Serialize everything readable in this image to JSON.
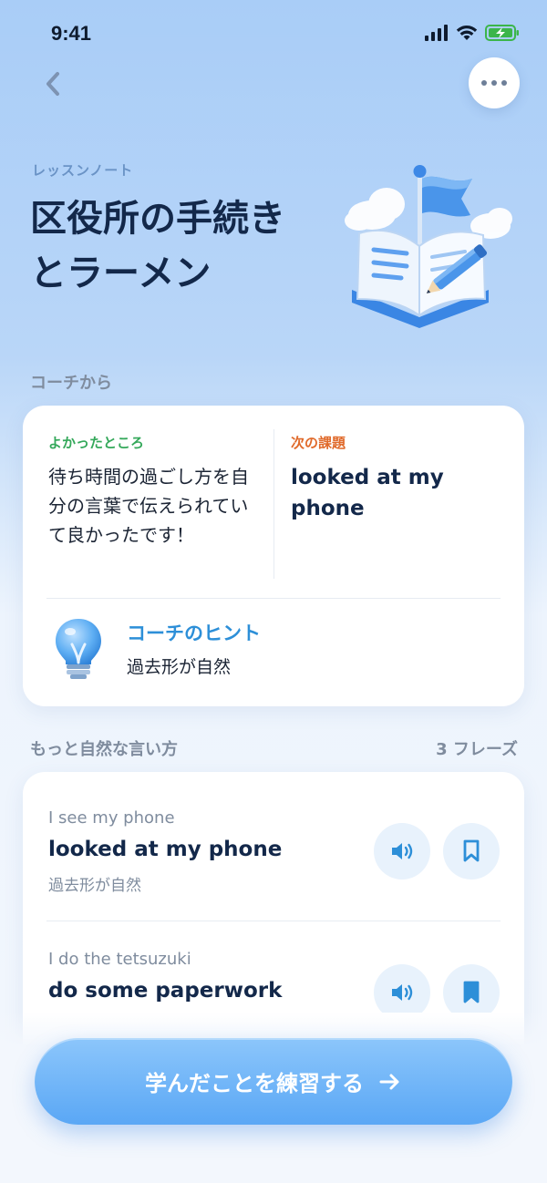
{
  "status_bar": {
    "time": "9:41"
  },
  "header": {
    "eyebrow": "レッスンノート",
    "title_line1": "区役所の手続き",
    "title_line2": "とラーメン"
  },
  "coach_section": {
    "label": "コーチから",
    "good": {
      "label": "よかったところ",
      "text": "待ち時間の過ごし方を自分の言葉で伝えられていて良かったです！"
    },
    "next": {
      "label": "次の課題",
      "text": "looked at my phone"
    },
    "hint": {
      "title": "コーチのヒント",
      "text": "過去形が自然"
    }
  },
  "phrases_section": {
    "label": "もっと自然な言い方",
    "count": "3 フレーズ",
    "items": [
      {
        "original": "I see my phone",
        "natural": "looked at my phone",
        "note": "過去形が自然",
        "bookmarked": false
      },
      {
        "original": "I do the tetsuzuki",
        "natural": "do some paperwork",
        "note": "",
        "bookmarked": true
      }
    ]
  },
  "cta": {
    "label": "学んだことを練習する"
  },
  "colors": {
    "accent": "#2d8fd8",
    "good": "#34a85a",
    "next": "#e06a2b",
    "title": "#13284a",
    "cta": "#5aa7f5"
  },
  "icons": {
    "back": "chevron-left-icon",
    "more": "more-icon",
    "audio": "speaker-icon",
    "bookmark": "bookmark-icon",
    "arrow": "arrow-right-icon",
    "hint": "lightbulb-icon"
  }
}
